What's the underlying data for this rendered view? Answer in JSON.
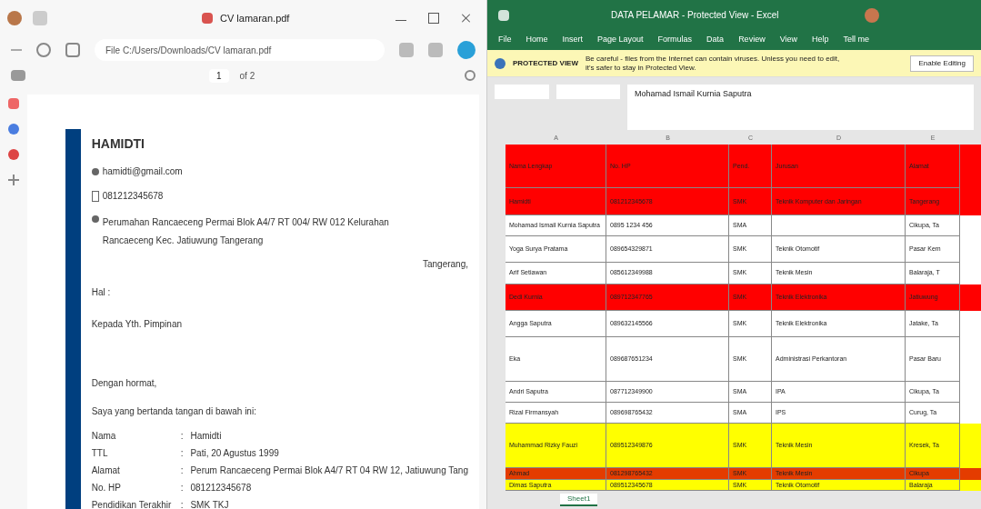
{
  "pdf_window": {
    "tab_title": "CV lamaran.pdf",
    "address": "File  C:/Users/Downloads/CV lamaran.pdf",
    "page_number": "1",
    "page_count": "of 2",
    "document": {
      "name": "HAMIDTI",
      "email": "hamidti@gmail.com",
      "phone": "081212345678",
      "address": "Perumahan Rancaeceng Permai Blok A4/7 RT 004/ RW 012 Kelurahan Rancaeceng Kec. Jatiuwung Tangerang",
      "date_label": "Tangerang,",
      "subject": "Hal :",
      "recipient": "Kepada Yth. Pimpinan",
      "greeting": "Dengan hormat,",
      "intro": "Saya yang bertanda tangan di bawah ini:",
      "fields": [
        {
          "label": "Nama",
          "separator": ":",
          "value": "Hamidti"
        },
        {
          "label": "TTL",
          "separator": ":",
          "value": "Pati, 20 Agustus 1999"
        },
        {
          "label": "Alamat",
          "separator": ":",
          "value": "Perum Rancaeceng Permai Blok A4/7 RT 04 RW 12, Jatiuwung Tang"
        },
        {
          "label": "No. HP",
          "separator": ":",
          "value": "081212345678"
        },
        {
          "label": "Pendidikan Terakhir",
          "separator": ":",
          "value": "SMK TKJ"
        }
      ]
    }
  },
  "excel_window": {
    "title": "DATA PELAMAR - Protected View - Excel",
    "ribbon_tabs": [
      "File",
      "Home",
      "Insert",
      "Page Layout",
      "Formulas",
      "Data",
      "Review",
      "View",
      "Help",
      "Tell me"
    ],
    "protected_bar": {
      "label": "PROTECTED VIEW",
      "message": "Be careful - files from the Internet can contain viruses. Unless you need to edit, it's safer to stay in Protected View.",
      "button": "Enable Editing"
    },
    "formula": "Mohamad Ismail Kurnia Saputra",
    "columns": [
      "A",
      "B",
      "C",
      "D",
      "E"
    ],
    "rows": [
      {
        "color": "#ff0000",
        "cells": [
          "Nama Lengkap",
          "No. HP",
          "Pend.",
          "Jurusan",
          "Alamat"
        ]
      },
      {
        "color": "#ff0000",
        "cells": [
          "Hamidti",
          "081212345678",
          "SMK",
          "Teknik Komputer dan Jaringan",
          "Tangerang"
        ]
      },
      {
        "color": "#ffffff",
        "cells": [
          "Mohamad Ismail Kurnia Saputra",
          "0895 1234 456",
          "SMA",
          "",
          "Cikupa, Ta"
        ]
      },
      {
        "color": "#ffffff",
        "cells": [
          "Yoga Surya Pratama",
          "089654329871",
          "SMK",
          "Teknik Otomotif",
          "Pasar Kem"
        ]
      },
      {
        "color": "#ffffff",
        "cells": [
          "Arif Setiawan",
          "085612349988",
          "SMK",
          "Teknik Mesin",
          "Balaraja, T"
        ]
      },
      {
        "color": "#ff0000",
        "cells": [
          "Dedi Kurnia",
          "089712347765",
          "SMK",
          "Teknik Elektronika",
          "Jatiuwung"
        ]
      },
      {
        "color": "#ffffff",
        "cells": [
          "Angga Saputra",
          "089632145566",
          "SMK",
          "Teknik Elektronika",
          "Jatake, Ta"
        ]
      },
      {
        "color": "#ffffff",
        "cells": [
          "Eka",
          "089687651234",
          "SMK",
          "Administrasi Perkantoran",
          "Pasar Baru"
        ]
      },
      {
        "color": "#ffffff",
        "cells": [
          "Andri Saputra",
          "087712349900",
          "SMA",
          "IPA",
          "Cikupa, Ta"
        ]
      },
      {
        "color": "#ffffff",
        "cells": [
          "Rizal Firmansyah",
          "089698765432",
          "SMA",
          "IPS",
          "Curug, Ta"
        ]
      },
      {
        "color": "#ffff00",
        "cells": [
          "Muhammad Rizky Fauzi",
          "089512349876",
          "SMK",
          "Teknik Mesin",
          "Kresek, Ta"
        ]
      },
      {
        "color": "#e43c00",
        "cells": [
          "Ahmad",
          "081298765432",
          "SMK",
          "Teknik Mesin",
          "Cikupa"
        ]
      },
      {
        "color": "#ffff00",
        "cells": [
          "Dimas Saputra",
          "089512345678",
          "SMK",
          "Teknik Otomotif",
          "Balaraja"
        ]
      }
    ],
    "sheet_tabs": [
      {
        "label": "Sheet1",
        "selected": true
      }
    ]
  }
}
